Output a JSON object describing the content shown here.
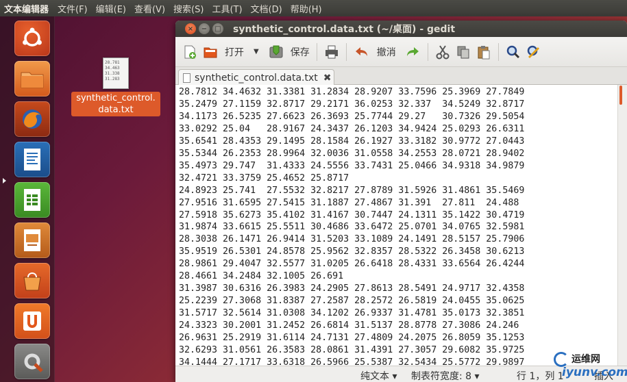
{
  "topbar": {
    "app_title": "文本编辑器",
    "menu": [
      "文件(F)",
      "编辑(E)",
      "查看(V)",
      "搜索(S)",
      "工具(T)",
      "文档(D)",
      "帮助(H)"
    ]
  },
  "launcher": {
    "items": [
      "ubuntu-logo-icon",
      "home-folder-icon",
      "firefox-icon",
      "writer-icon",
      "calc-icon",
      "impress-icon",
      "software-center-icon",
      "ubuntu-one-icon",
      "system-settings-icon"
    ]
  },
  "desktop": {
    "file_label": "synthetic_control.\ndata.txt",
    "file_preview": "28.781\n34.463\n31.338\n31.283"
  },
  "window": {
    "title": "synthetic_control.data.txt (~/桌面) - gedit",
    "toolbar": {
      "open_label": "打开",
      "save_label": "保存",
      "undo_label": "撤消"
    },
    "tab_label": "synthetic_control.data.txt",
    "lines": [
      "28.7812 34.4632 31.3381 31.2834 28.9207 33.7596 25.3969 27.7849",
      "35.2479 27.1159 32.8717 29.2171 36.0253 32.337  34.5249 32.8717",
      "34.1173 26.5235 27.6623 26.3693 25.7744 29.27   30.7326 29.5054",
      "33.0292 25.04   28.9167 24.3437 26.1203 34.9424 25.0293 26.6311",
      "35.6541 28.4353 29.1495 28.1584 26.1927 33.3182 30.9772 27.0443",
      "35.5344 26.2353 28.9964 32.0036 31.0558 34.2553 28.0721 28.9402",
      "35.4973 29.747  31.4333 24.5556 33.7431 25.0466 34.9318 34.9879",
      "32.4721 33.3759 25.4652 25.8717",
      "24.8923 25.741  27.5532 32.8217 27.8789 31.5926 31.4861 35.5469",
      "27.9516 31.6595 27.5415 31.1887 27.4867 31.391  27.811  24.488",
      "27.5918 35.6273 35.4102 31.4167 30.7447 24.1311 35.1422 30.4719",
      "31.9874 33.6615 25.5511 30.4686 33.6472 25.0701 34.0765 32.5981",
      "28.3038 26.1471 26.9414 31.5203 33.1089 24.1491 28.5157 25.7906",
      "35.9519 26.5301 24.8578 25.9562 32.8357 28.5322 26.3458 30.6213",
      "28.9861 29.4047 32.5577 31.0205 26.6418 28.4331 33.6564 26.4244",
      "28.4661 34.2484 32.1005 26.691",
      "31.3987 30.6316 26.3983 24.2905 27.8613 28.5491 24.9717 32.4358",
      "25.2239 27.3068 31.8387 27.2587 28.2572 26.5819 24.0455 35.0625",
      "31.5717 32.5614 31.0308 34.1202 26.9337 31.4781 35.0173 32.3851",
      "24.3323 30.2001 31.2452 26.6814 31.5137 28.8778 27.3086 24.246",
      "26.9631 25.2919 31.6114 24.7131 27.4809 24.2075 26.8059 35.1253",
      "32.6293 31.0561 26.3583 28.0861 31.4391 27.3057 29.6082 35.9725",
      "34.1444 27.1717 33.6318 26.5966 25.5387 32.5434 25.5772 29.9897"
    ],
    "status": {
      "mode": "纯文本 ▾",
      "tab_width": "制表符宽度: 8 ▾",
      "position": "行 1，列 1",
      "insert": "插入"
    }
  },
  "watermark": {
    "line1": "运维网",
    "line2": "iyunv.com"
  }
}
